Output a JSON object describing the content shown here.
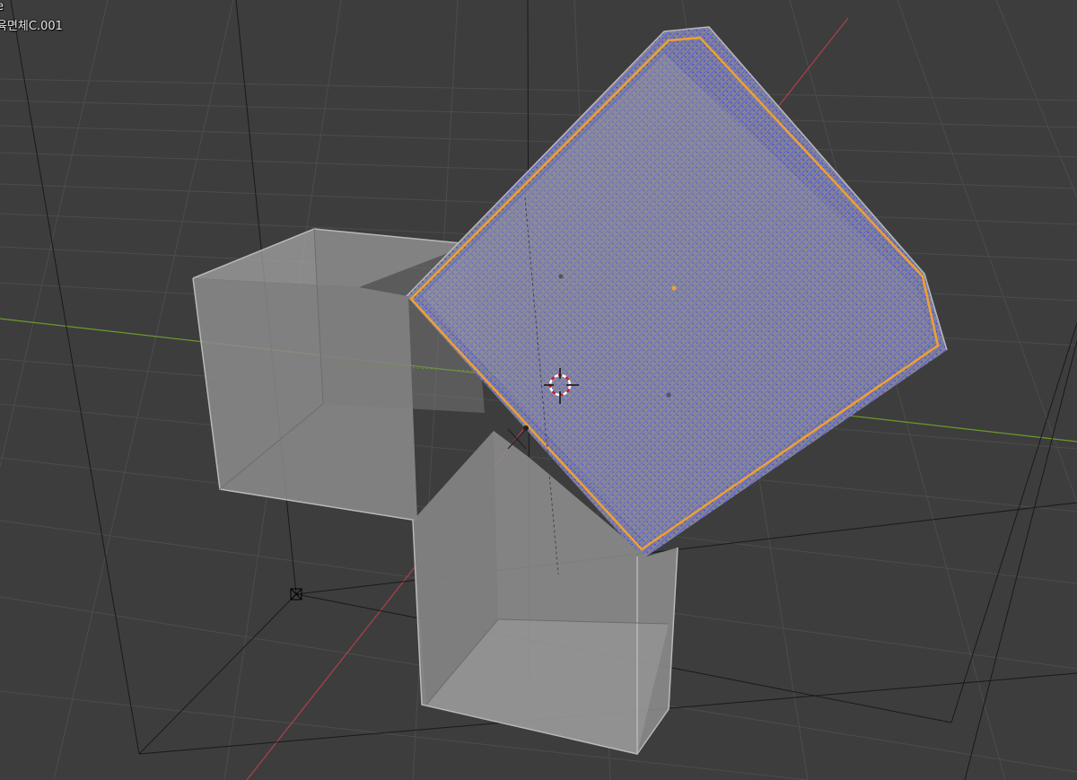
{
  "viewport": {
    "view_mode": "e",
    "object_name": "육면체C.001"
  },
  "colors": {
    "background": "#3d3d3d",
    "grid_line": "#4b4b4b",
    "x_axis": "#b0404c",
    "y_axis": "#6a9a2c",
    "selection_outline": "#f0a030",
    "particles": "#5a5cf0",
    "box_face": "#9a9a9a",
    "box_edge": "#b4b4b4"
  }
}
